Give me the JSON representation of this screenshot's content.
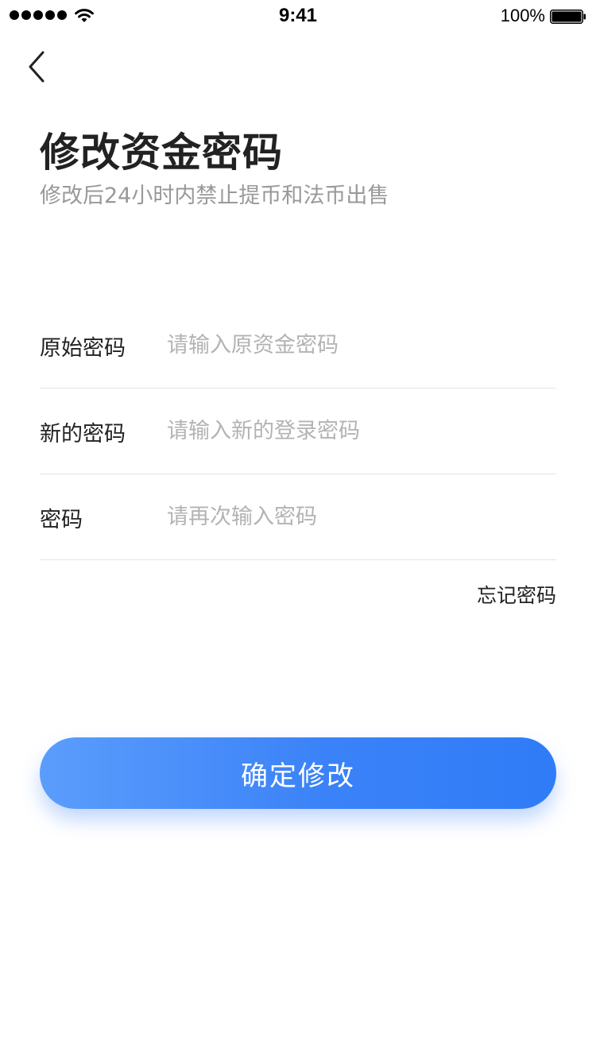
{
  "status_bar": {
    "time": "9:41",
    "battery_percent": "100%",
    "signal_icon": "cellular-signal-dots",
    "wifi_icon": "wifi-icon",
    "battery_icon": "battery-full-icon"
  },
  "nav": {
    "back_icon": "chevron-left-icon"
  },
  "header": {
    "title": "修改资金密码",
    "subtitle": "修改后24小时内禁止提币和法币出售"
  },
  "form": {
    "original_password": {
      "label": "原始密码",
      "placeholder": "请输入原资金密码",
      "value": ""
    },
    "new_password": {
      "label": "新的密码",
      "placeholder": "请输入新的登录密码",
      "value": ""
    },
    "confirm_password": {
      "label": "密码",
      "placeholder": "请再次输入密码",
      "value": ""
    }
  },
  "forgot_password_label": "忘记密码",
  "submit_label": "确定修改",
  "colors": {
    "accent": "#3b82f8",
    "accent_light": "#5b9dfc",
    "title": "#222222",
    "subtitle": "#999999",
    "placeholder": "#b3b3b3",
    "divider": "#e4e4e4"
  }
}
